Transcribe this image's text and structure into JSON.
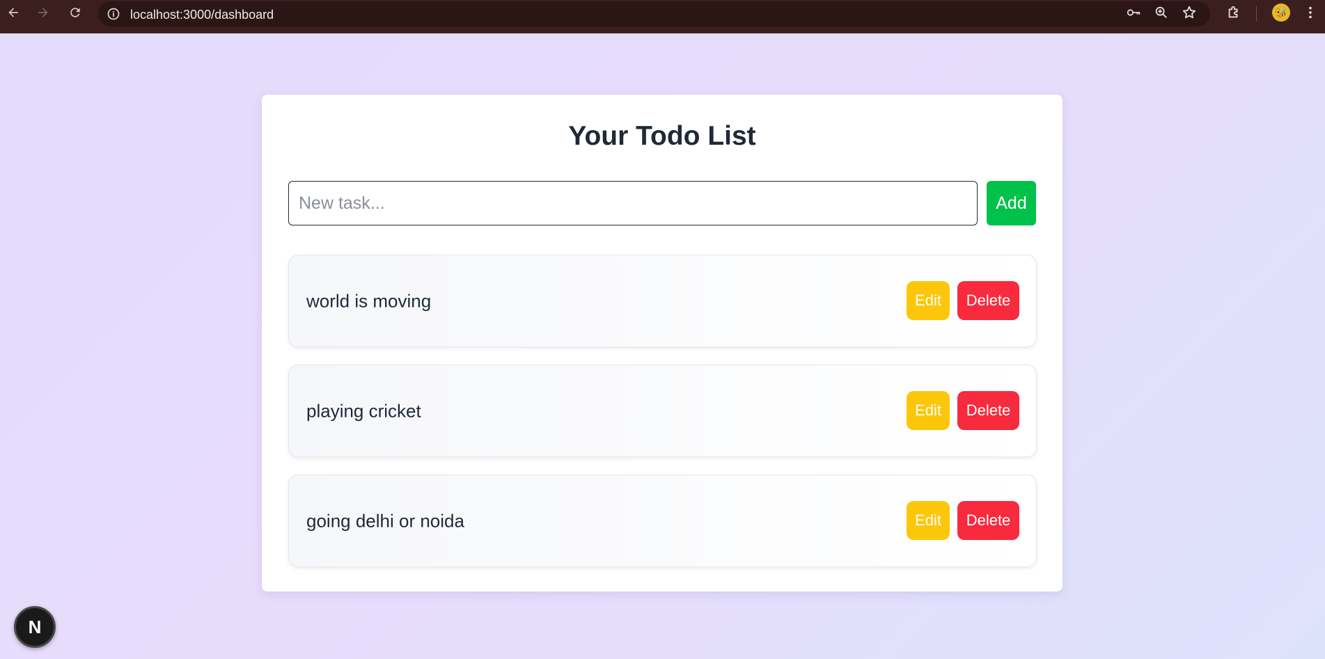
{
  "browser": {
    "url": "localhost:3000/dashboard",
    "profile_initial": "🐝"
  },
  "main": {
    "title": "Your Todo List",
    "input_placeholder": "New task...",
    "add_label": "Add",
    "edit_label": "Edit",
    "delete_label": "Delete"
  },
  "todos": [
    {
      "text": "world is moving"
    },
    {
      "text": "playing cricket"
    },
    {
      "text": "going delhi or noida"
    }
  ],
  "dev_badge": "N",
  "colors": {
    "add": "#00c24a",
    "edit": "#fcc70a",
    "delete": "#f82a3e",
    "chrome": "#3b1f1f"
  }
}
